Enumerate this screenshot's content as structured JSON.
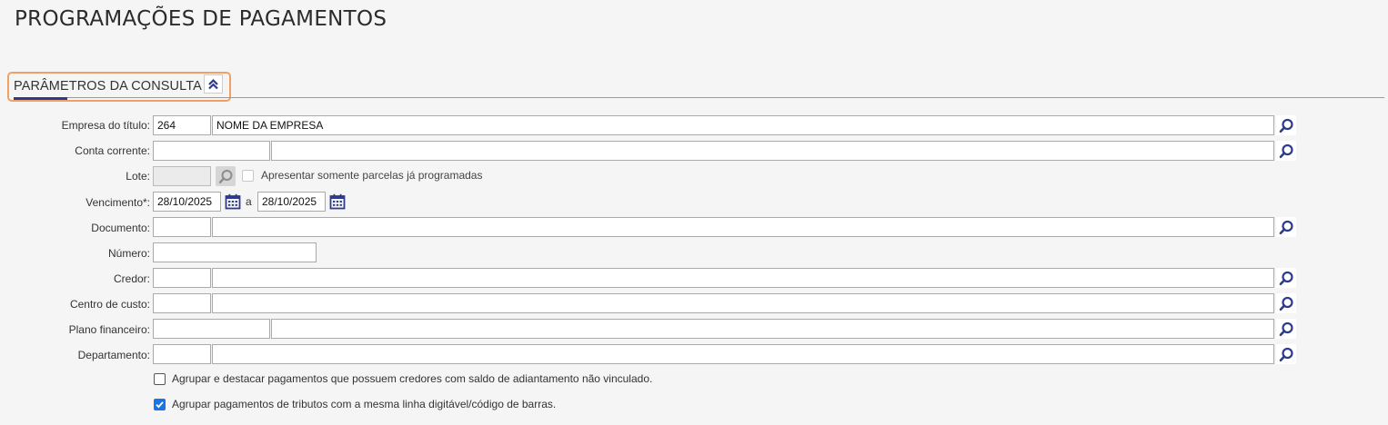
{
  "page": {
    "title": "PROGRAMAÇÕES DE PAGAMENTOS"
  },
  "section": {
    "title": "PARÂMETROS DA CONSULTA",
    "collapse_icon": "double-chevron-up-icon"
  },
  "colors": {
    "accent": "#2e3a8c",
    "highlight_border": "#f0a066",
    "checkbox_checked": "#1a73e8"
  },
  "form": {
    "empresa": {
      "label": "Empresa do título:",
      "code": "264",
      "name": "NOME DA EMPRESA"
    },
    "conta": {
      "label": "Conta corrente:",
      "code": "",
      "name": ""
    },
    "lote": {
      "label": "Lote:",
      "value": "",
      "checkbox_label": "Apresentar somente parcelas já programadas",
      "checked": false
    },
    "vencimento": {
      "label": "Vencimento*:",
      "from": "28/10/2025",
      "separator": "a",
      "to": "28/10/2025"
    },
    "documento": {
      "label": "Documento:",
      "code": "",
      "name": ""
    },
    "numero": {
      "label": "Número:",
      "value": ""
    },
    "credor": {
      "label": "Credor:",
      "code": "",
      "name": ""
    },
    "centro": {
      "label": "Centro de custo:",
      "code": "",
      "name": ""
    },
    "plano": {
      "label": "Plano financeiro:",
      "code": "",
      "name": ""
    },
    "departamento": {
      "label": "Departamento:",
      "code": "",
      "name": ""
    },
    "agrupar_credores": {
      "label": "Agrupar e destacar pagamentos que possuem credores com saldo de adiantamento não vinculado.",
      "checked": false
    },
    "agrupar_tributos": {
      "label": "Agrupar pagamentos de tributos com a mesma linha digitável/código de barras.",
      "checked": true
    }
  }
}
